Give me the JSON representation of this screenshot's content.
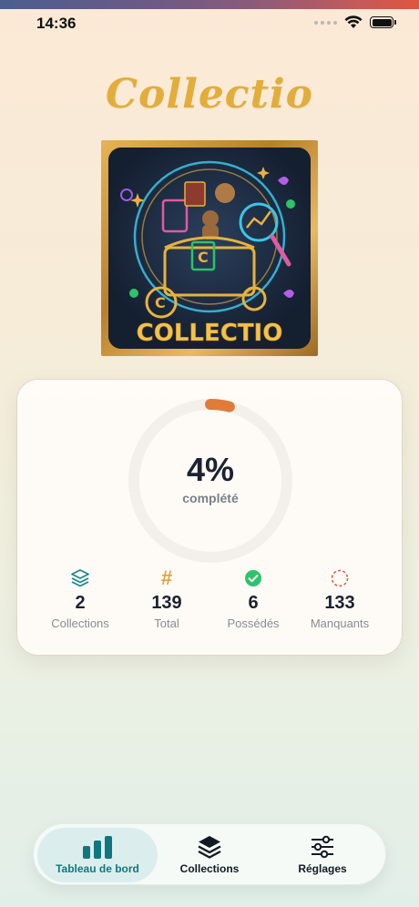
{
  "status_bar": {
    "time": "14:36"
  },
  "app": {
    "title": "Collectio",
    "logo_text": "COLLECTIO"
  },
  "progress": {
    "percent_text": "4%",
    "percent_value": 0.04,
    "label": "complété",
    "accent": "#e07b39"
  },
  "stats": [
    {
      "icon": "layers-icon",
      "value": "2",
      "label": "Collections",
      "color": "#1a8a93"
    },
    {
      "icon": "hash-icon",
      "value": "139",
      "label": "Total",
      "color": "#e2a23a"
    },
    {
      "icon": "check-circle-icon",
      "value": "6",
      "label": "Possédés",
      "color": "#2ec36a"
    },
    {
      "icon": "dashed-circle-icon",
      "value": "133",
      "label": "Manquants",
      "color": "#e05a4a"
    }
  ],
  "tabbar": {
    "tabs": [
      {
        "label": "Tableau de bord",
        "icon": "bar-chart-icon",
        "active": true
      },
      {
        "label": "Collections",
        "icon": "stack-icon",
        "active": false
      },
      {
        "label": "Réglages",
        "icon": "sliders-icon",
        "active": false
      }
    ],
    "active_color": "#11777f"
  }
}
